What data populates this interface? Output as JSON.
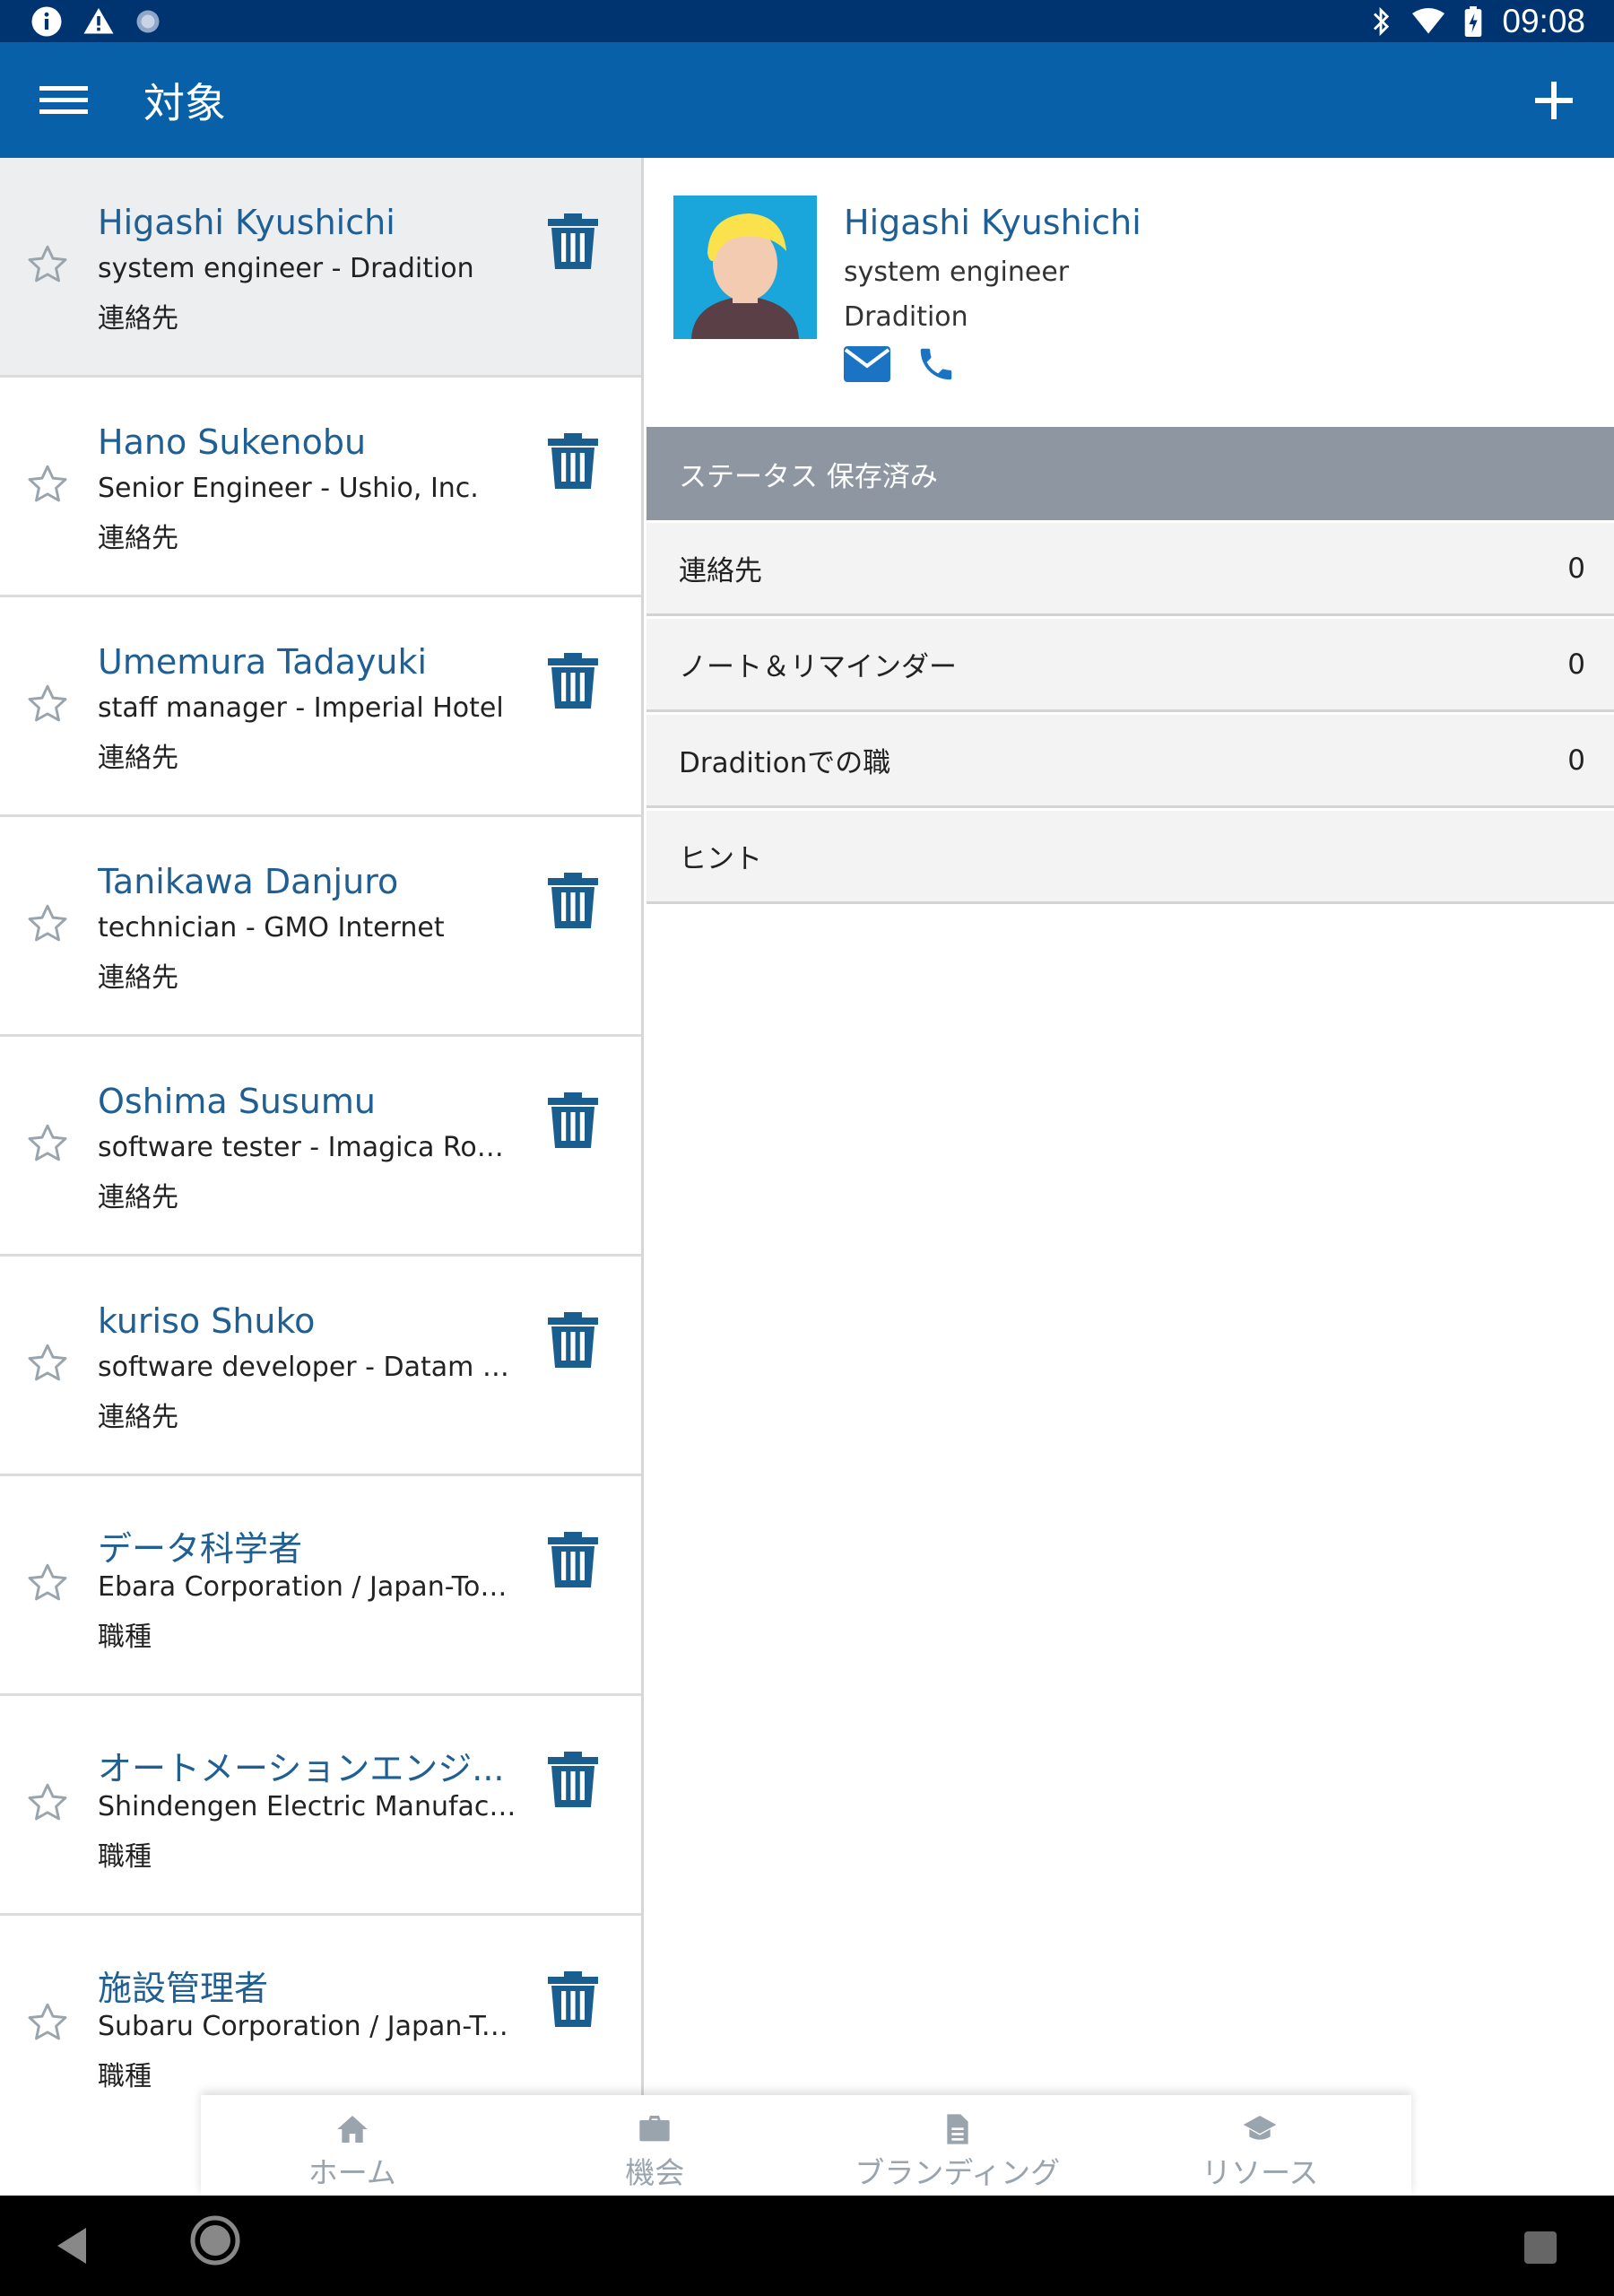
{
  "status_bar": {
    "time": "09:08"
  },
  "app_bar": {
    "title": "対象"
  },
  "contacts": [
    {
      "name": "Higashi Kyushichi",
      "subtitle": "system engineer - Dradition",
      "type": "連絡先"
    },
    {
      "name": "Hano Sukenobu",
      "subtitle": "Senior Engineer - Ushio, Inc.",
      "type": "連絡先"
    },
    {
      "name": "Umemura Tadayuki",
      "subtitle": "staff manager - Imperial Hotel",
      "type": "連絡先"
    },
    {
      "name": "Tanikawa Danjuro",
      "subtitle": "technician - GMO Internet",
      "type": "連絡先"
    },
    {
      "name": "Oshima Susumu",
      "subtitle": "software tester - Imagica Robot ...",
      "type": "連絡先"
    },
    {
      "name": "kuriso Shuko",
      "subtitle": "software developer - Datam Poly...",
      "type": "連絡先"
    },
    {
      "name": "データ科学者",
      "subtitle": "Ebara Corporation / Japan-Tokyo-",
      "type": "職種"
    },
    {
      "name": "オートメーションエンジ...",
      "subtitle": "Shindengen Electric Manufacturi...",
      "type": "職種"
    },
    {
      "name": "施設管理者",
      "subtitle": "Subaru Corporation / Japan-Toky...",
      "type": "職種"
    }
  ],
  "detail": {
    "name": "Higashi Kyushichi",
    "role": "system engineer",
    "company": "Dradition",
    "status": "ステータス 保存済み",
    "rows": [
      {
        "label": "連絡先",
        "count": "0"
      },
      {
        "label": "ノート＆リマインダー",
        "count": "0"
      },
      {
        "label": "Draditionでの職",
        "count": "0"
      },
      {
        "label": "ヒント",
        "count": ""
      }
    ]
  },
  "bottom_nav": [
    {
      "label": "ホーム",
      "icon": "home-icon"
    },
    {
      "label": "機会",
      "icon": "briefcase-icon"
    },
    {
      "label": "ブランディング",
      "icon": "document-icon"
    },
    {
      "label": "リソース",
      "icon": "graduation-cap-icon"
    }
  ],
  "colors": {
    "app_bar": "#0860a8",
    "status_bar": "#003471",
    "accent_text": "#1f5f94",
    "status_row": "#8e96a1"
  }
}
